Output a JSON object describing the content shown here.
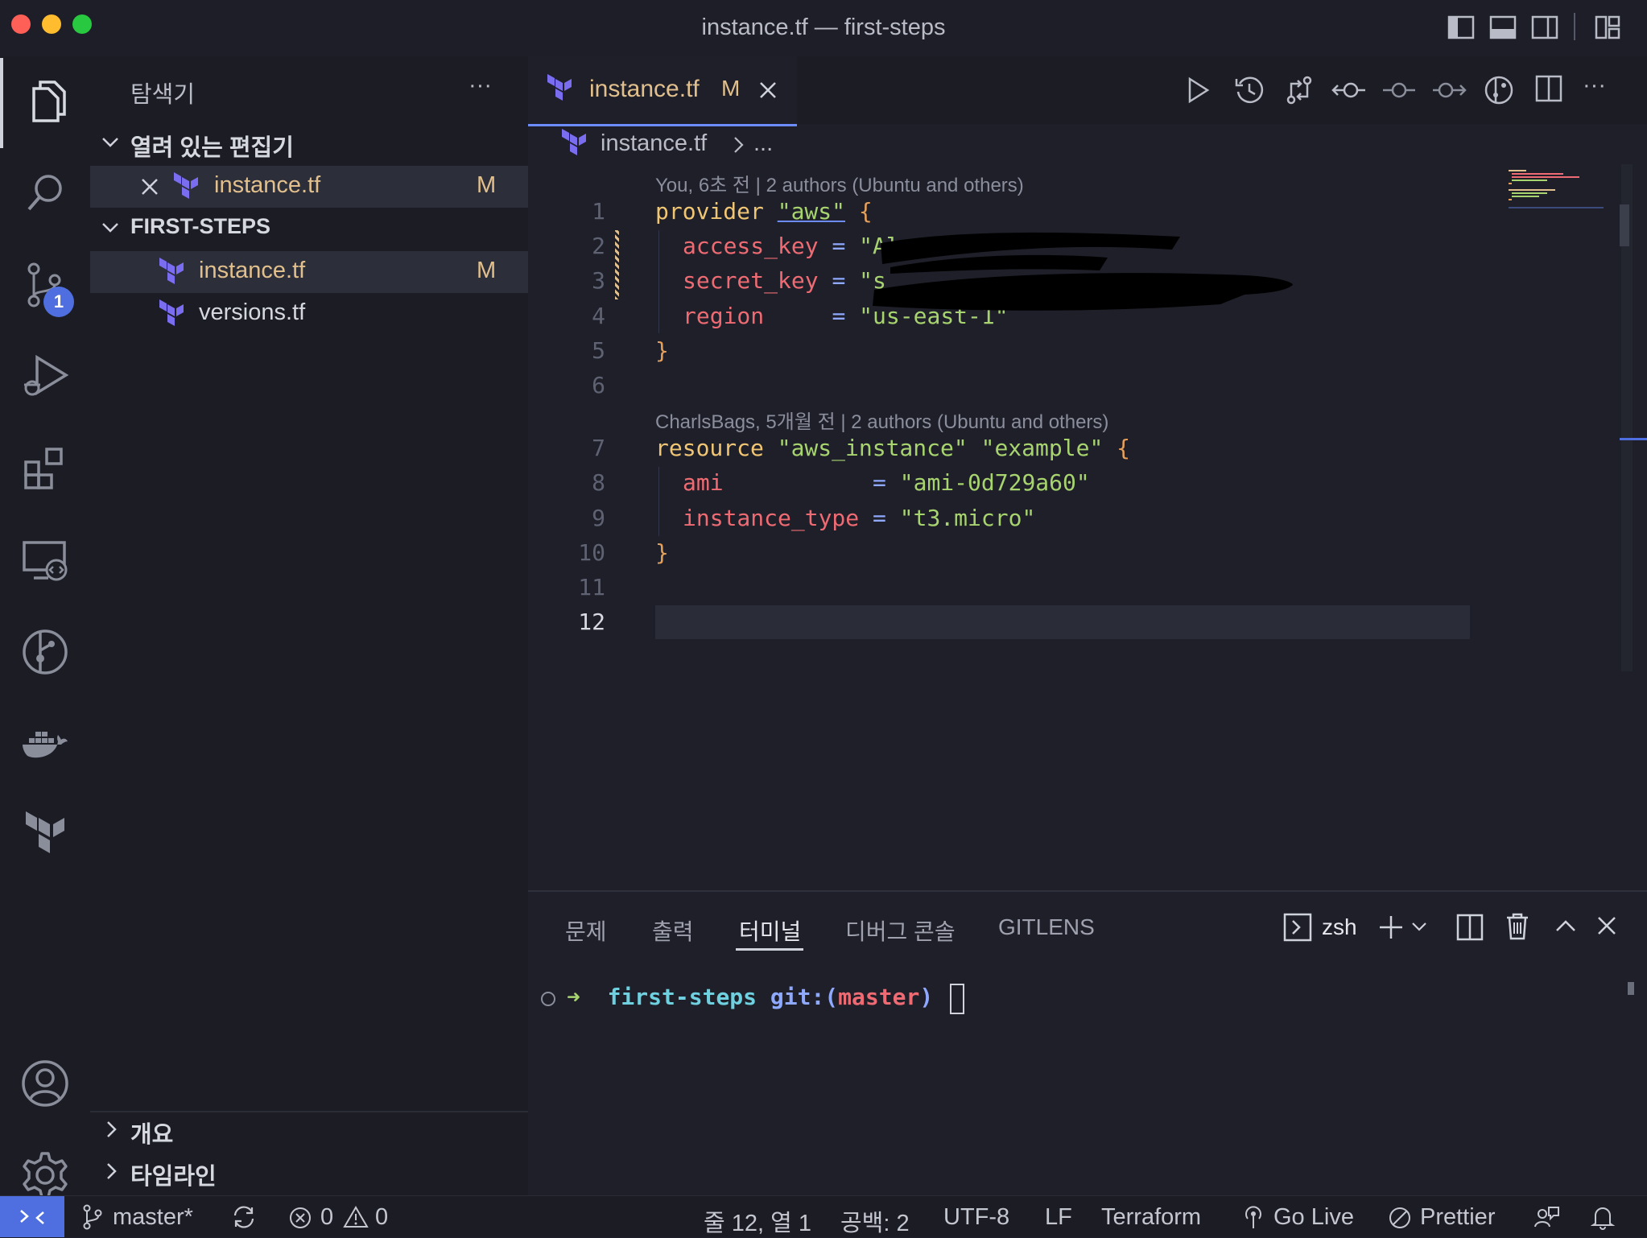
{
  "window": {
    "title": "instance.tf — first-steps"
  },
  "activity_bar": {
    "scm_badge": "1"
  },
  "sidebar": {
    "header": "탐색기",
    "more": "···",
    "open_editors": {
      "label": "열려 있는 편집기",
      "items": [
        {
          "name": "instance.tf",
          "badge": "M"
        }
      ]
    },
    "folder": {
      "label": "FIRST-STEPS",
      "items": [
        {
          "name": "instance.tf",
          "badge": "M"
        },
        {
          "name": "versions.tf",
          "badge": ""
        }
      ]
    },
    "outline_label": "개요",
    "timeline_label": "타임라인"
  },
  "editor": {
    "tab": {
      "name": "instance.tf",
      "badge": "M"
    },
    "breadcrumb": {
      "file": "instance.tf",
      "rest": "..."
    },
    "blame_1": "You, 6초 전 | 2 authors (Ubuntu and others)",
    "blame_2": "CharlsBags, 5개월 전 | 2 authors (Ubuntu and others)",
    "line_numbers": [
      "1",
      "2",
      "3",
      "4",
      "5",
      "6",
      "7",
      "8",
      "9",
      "10",
      "11",
      "12"
    ],
    "code": {
      "l1_kw": "provider",
      "l1_str": "\"aws\"",
      "l1_brace": "{",
      "l2_key": "access_key",
      "l2_eq": "=",
      "l2_val": "\"Al",
      "l3_key": "secret_key",
      "l3_eq": "=",
      "l3_val": "\"s",
      "l4_key": "region",
      "l4_eq": "=",
      "l4_val": "\"us-east-1\"",
      "l5": "}",
      "l7_kw": "resource",
      "l7_s1": "\"aws_instance\"",
      "l7_s2": "\"example\"",
      "l7_brace": "{",
      "l8_key": "ami",
      "l8_eq": "=",
      "l8_val": "\"ami-0d729a60\"",
      "l9_key": "instance_type",
      "l9_eq": "=",
      "l9_val": "\"t3.micro\"",
      "l10": "}"
    }
  },
  "panel": {
    "tabs": [
      "문제",
      "출력",
      "터미널",
      "디버그 콘솔",
      "GITLENS"
    ],
    "active_tab": "터미널",
    "shell": "zsh",
    "prompt": {
      "arrow": "➜",
      "dir": "first-steps",
      "git": "git:(",
      "branch": "master",
      "close": ")"
    }
  },
  "status_bar": {
    "branch": "master*",
    "errors": "0",
    "warnings": "0",
    "position": "줄 12, 열 1",
    "spaces": "공백: 2",
    "encoding": "UTF-8",
    "eol": "LF",
    "language": "Terraform",
    "go_live": "Go Live",
    "prettier": "Prettier"
  },
  "colors": {
    "accent": "#6c8cff",
    "terraform": "#7b6df0",
    "modified": "#e2c08d"
  }
}
